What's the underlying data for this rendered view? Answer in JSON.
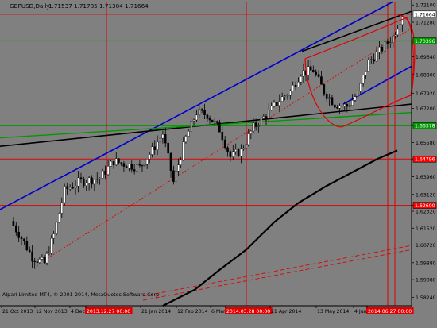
{
  "header": {
    "symbol": "GBPUSD,Daily",
    "ohlc": "1.71537 1.71785 1.71304 1.71664"
  },
  "footer": {
    "copyright": "Alpari Limited MT4, © 2001-2014, MetaQuotes Software Corp."
  },
  "colors": {
    "background": "#808080",
    "candles": "#000000",
    "level_lines": "#e00000",
    "green_lines": "#009a00",
    "trend_blue": "#0000cc",
    "trend_black": "#000000",
    "moving_average": "#000000",
    "price_badge_red": "#ff0000",
    "price_badge_green": "#009a00",
    "price_badge_white": "#ffffff"
  },
  "chart_data": {
    "type": "candlestick",
    "title": "GBPUSD,Daily",
    "ylim": [
      1.5784,
      1.7226
    ],
    "y_ticks": [
      "1.72100",
      "1.71280",
      "1.70396",
      "1.69640",
      "1.68800",
      "1.67920",
      "1.67200",
      "1.66378",
      "1.65580",
      "1.64796",
      "1.63960",
      "1.63120",
      "1.62600",
      "1.62320",
      "1.61520",
      "1.60720",
      "1.59880",
      "1.59080",
      "1.58240"
    ],
    "y_tick_values": [
      1.721,
      1.7128,
      1.70396,
      1.6964,
      1.688,
      1.6792,
      1.672,
      1.66378,
      1.6558,
      1.64796,
      1.6396,
      1.6312,
      1.626,
      1.6232,
      1.6152,
      1.6072,
      1.5988,
      1.5908,
      1.5824
    ],
    "x_labels": [
      "21 Oct 2013",
      "12 Nov 2013",
      "4 Dec 2013",
      "2013.12.27 00:00",
      "21 Jan 2014",
      "12 Feb 2014",
      "6 Mar 2014",
      "2014.03.28 00:00",
      "21 Apr 2014",
      "13 May 2014",
      "4 Jun 2014",
      "2014.06.27 00:00"
    ],
    "highlight_x_labels": [
      "2013.12.27 00:00",
      "2014.03.28 00:00",
      "2014.06.27 00:00"
    ],
    "price_badges": [
      {
        "label": "1.71664",
        "price": 1.71664,
        "style": "white"
      },
      {
        "label": "1.70396",
        "price": 1.70396,
        "style": "green"
      },
      {
        "label": "1.66378",
        "price": 1.66378,
        "style": "green"
      },
      {
        "label": "1.64796",
        "price": 1.64796,
        "style": "red"
      },
      {
        "label": "1.62600",
        "price": 1.626,
        "style": "red"
      }
    ],
    "horizontal_levels": [
      {
        "price": 1.71664,
        "color": "red"
      },
      {
        "price": 1.70396,
        "color": "green"
      },
      {
        "price": 1.66378,
        "color": "green"
      },
      {
        "price": 1.64796,
        "color": "red"
      },
      {
        "price": 1.626,
        "color": "red"
      }
    ],
    "vertical_markers": [
      "2013.12.27 00:00",
      "2014.03.28 00:00",
      "2014.06.27 00:00"
    ],
    "close_path": [
      {
        "date": "2013-10-21",
        "close": 1.6185
      },
      {
        "date": "2013-10-28",
        "close": 1.6105
      },
      {
        "date": "2013-11-04",
        "close": 1.6015
      },
      {
        "date": "2013-11-12",
        "close": 1.5985
      },
      {
        "date": "2013-11-18",
        "close": 1.612
      },
      {
        "date": "2013-11-25",
        "close": 1.633
      },
      {
        "date": "2013-12-04",
        "close": 1.637
      },
      {
        "date": "2013-12-11",
        "close": 1.638
      },
      {
        "date": "2013-12-18",
        "close": 1.639
      },
      {
        "date": "2013-12-27",
        "close": 1.647
      },
      {
        "date": "2014-01-06",
        "close": 1.645
      },
      {
        "date": "2014-01-13",
        "close": 1.644
      },
      {
        "date": "2014-01-21",
        "close": 1.652
      },
      {
        "date": "2014-01-28",
        "close": 1.66
      },
      {
        "date": "2014-02-04",
        "close": 1.637
      },
      {
        "date": "2014-02-12",
        "close": 1.658
      },
      {
        "date": "2014-02-19",
        "close": 1.67
      },
      {
        "date": "2014-02-26",
        "close": 1.669
      },
      {
        "date": "2014-03-06",
        "close": 1.662
      },
      {
        "date": "2014-03-13",
        "close": 1.649
      },
      {
        "date": "2014-03-20",
        "close": 1.652
      },
      {
        "date": "2014-03-28",
        "close": 1.663
      },
      {
        "date": "2014-04-07",
        "close": 1.67
      },
      {
        "date": "2014-04-14",
        "close": 1.676
      },
      {
        "date": "2014-04-21",
        "close": 1.68
      },
      {
        "date": "2014-04-28",
        "close": 1.689
      },
      {
        "date": "2014-05-06",
        "close": 1.69
      },
      {
        "date": "2014-05-13",
        "close": 1.68
      },
      {
        "date": "2014-05-20",
        "close": 1.674
      },
      {
        "date": "2014-05-28",
        "close": 1.673
      },
      {
        "date": "2014-06-04",
        "close": 1.679
      },
      {
        "date": "2014-06-11",
        "close": 1.694
      },
      {
        "date": "2014-06-18",
        "close": 1.699
      },
      {
        "date": "2014-06-27",
        "close": 1.706
      },
      {
        "date": "2014-07-03",
        "close": 1.7166
      }
    ]
  }
}
